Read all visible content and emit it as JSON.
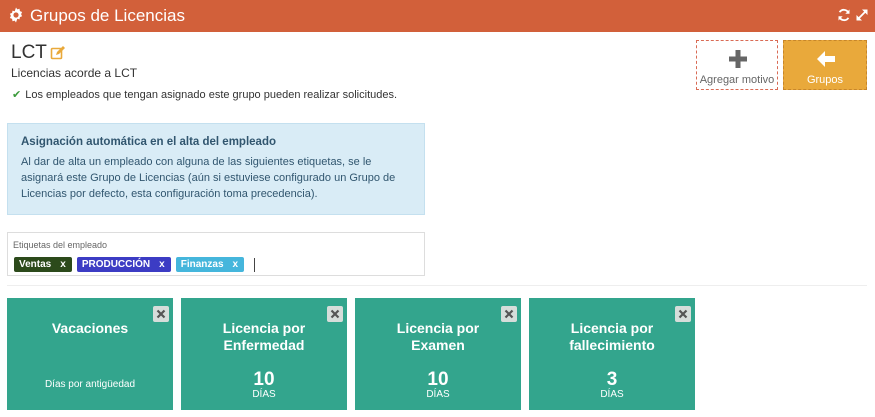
{
  "window": {
    "title": "Grupos de Licencias"
  },
  "group": {
    "name": "LCT",
    "description": "Licencias acorde a LCT",
    "note": "Los empleados que tengan asignado este grupo pueden realizar solicitudes."
  },
  "actions": {
    "add_label": "Agregar motivo",
    "groups_label": "Grupos"
  },
  "info": {
    "heading": "Asignación automática en el alta del empleado",
    "body": "Al dar de alta un empleado con alguna de las siguientes etiquetas, se le asignará este Grupo de Licencias (aún si estuviese configurado un Grupo de Licencias por defecto, esta configuración toma precedencia)."
  },
  "tags_field": {
    "label": "Etiquetas del empleado",
    "remove_label": "x",
    "tags": [
      {
        "label": "Ventas",
        "color": "#2c4a1b"
      },
      {
        "label": "PRODUCCIÓN",
        "color": "#3c3cc4"
      },
      {
        "label": "Finanzas",
        "color": "#45b6dc"
      }
    ]
  },
  "cards": [
    {
      "title_line1": "Vacaciones",
      "title_line2": "",
      "caption": "Días por antigüedad",
      "value": "",
      "unit": ""
    },
    {
      "title_line1": "Licencia por",
      "title_line2": "Enfermedad",
      "caption": "",
      "value": "10",
      "unit": "DÍAS"
    },
    {
      "title_line1": "Licencia por",
      "title_line2": "Examen",
      "caption": "",
      "value": "10",
      "unit": "DÍAS"
    },
    {
      "title_line1": "Licencia por",
      "title_line2": "fallecimiento",
      "caption": "",
      "value": "3",
      "unit": "DÍAS"
    }
  ],
  "colors": {
    "titlebar": "#d2603a",
    "card": "#33a58d",
    "groups_button": "#e9a93b",
    "info_box": "#d9ecf6"
  },
  "icons": {
    "title": "gear-icon",
    "refresh": "refresh-icon",
    "expand": "expand-icon",
    "edit": "edit-icon",
    "add": "plus-icon",
    "back": "arrow-left-icon",
    "check": "check-icon",
    "close": "close-icon"
  }
}
